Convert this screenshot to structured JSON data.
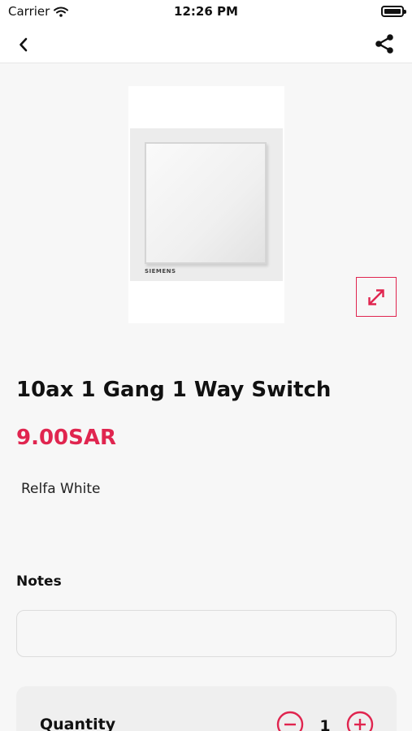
{
  "status_bar": {
    "carrier": "Carrier",
    "time": "12:26 PM"
  },
  "product": {
    "title": "10ax 1 Gang 1 Way Switch",
    "price": "9.00SAR",
    "variant": "Relfa White",
    "image_brand_text": "SIEMENS"
  },
  "notes": {
    "label": "Notes",
    "value": "",
    "placeholder": ""
  },
  "quantity": {
    "label": "Quantity",
    "value": "1"
  },
  "colors": {
    "accent": "#e0254f",
    "background": "#f7f7f7"
  },
  "icons": {
    "back": "chevron-left-icon",
    "share": "share-icon",
    "expand": "expand-icon",
    "minus": "minus-circle-icon",
    "plus": "plus-circle-icon"
  }
}
